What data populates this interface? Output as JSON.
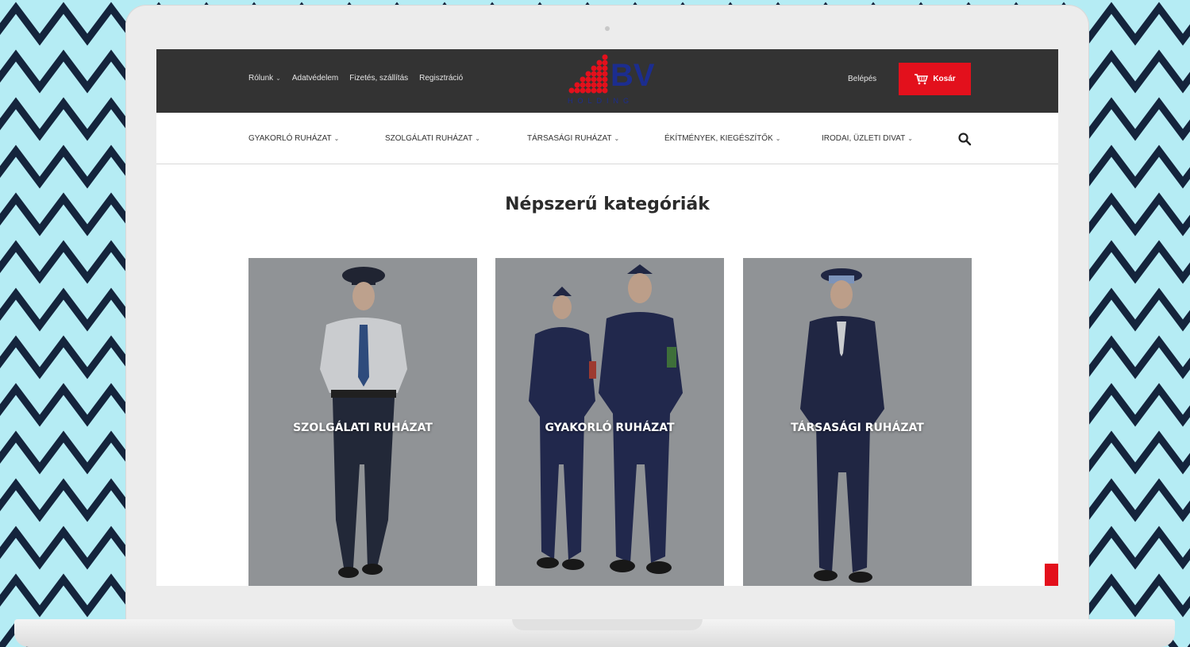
{
  "colors": {
    "background": "#b5ecf4",
    "stripe": "#14243c",
    "topbar": "#333333",
    "accent_red": "#e3101c",
    "logo_blue": "#1c2d8f"
  },
  "topbar": {
    "links": [
      {
        "label": "Rólunk",
        "has_dropdown": true
      },
      {
        "label": "Adatvédelem",
        "has_dropdown": false
      },
      {
        "label": "Fizetés, szállítás",
        "has_dropdown": false
      },
      {
        "label": "Regisztráció",
        "has_dropdown": false
      }
    ],
    "logo_text": "BV",
    "logo_subtext": "HOLDING",
    "login_label": "Belépés",
    "cart_label": "Kosár",
    "cart_icon": "cart-icon"
  },
  "nav": {
    "items": [
      {
        "label": "GYAKORLÓ RUHÁZAT"
      },
      {
        "label": "SZOLGÁLATI RUHÁZAT"
      },
      {
        "label": "TÁRSASÁGI RUHÁZAT"
      },
      {
        "label": "ÉKÍTMÉNYEK, KIEGÉSZÍTŐK"
      },
      {
        "label": "IRODAI, ÜZLETI DIVAT"
      }
    ],
    "search_icon": "search-icon"
  },
  "main": {
    "title": "Népszerű kategóriák",
    "categories": [
      {
        "label": "SZOLGÁLATI RUHÁZAT"
      },
      {
        "label": "GYAKORLÓ RUHÁZAT"
      },
      {
        "label": "TÁRSASÁGI RUHÁZAT"
      }
    ]
  }
}
